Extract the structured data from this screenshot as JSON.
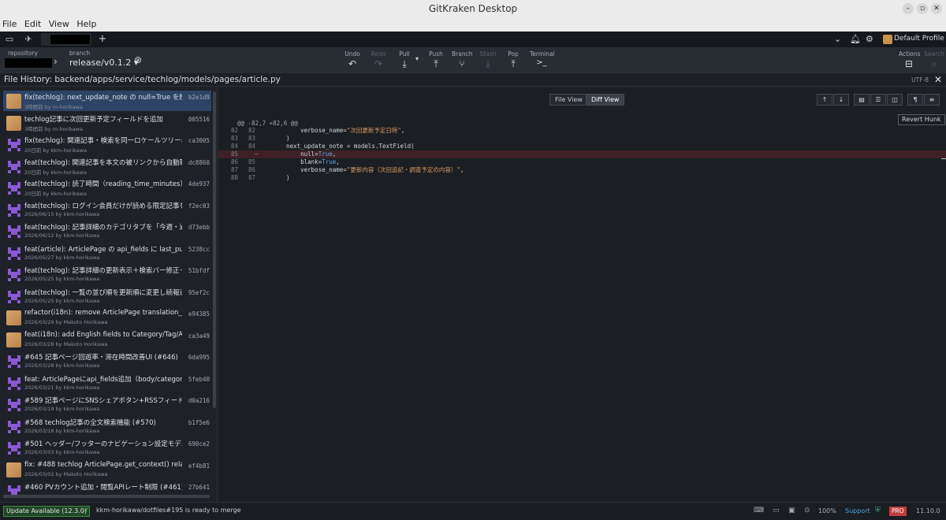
{
  "window": {
    "title": "GitKraken Desktop"
  },
  "menu": [
    "File",
    "Edit",
    "View",
    "Help"
  ],
  "tabbar": {
    "profile": "Default Profile",
    "add_tab": "+"
  },
  "toolbar": {
    "repository_label": "repository",
    "branch_label": "branch",
    "branch_name": "release/v0.1.2",
    "actions": [
      {
        "label": "Undo",
        "icon": "↶"
      },
      {
        "label": "Redo",
        "icon": "↷"
      },
      {
        "label": "Pull",
        "icon": "⤓"
      },
      {
        "label": "Push",
        "icon": "⤒"
      },
      {
        "label": "Branch",
        "icon": "⑂"
      },
      {
        "label": "Stash",
        "icon": "⤓"
      },
      {
        "label": "Pop",
        "icon": "⤒"
      },
      {
        "label": "Terminal",
        "icon": ">_"
      }
    ],
    "right_actions": [
      "Actions",
      "Search"
    ]
  },
  "file_history": {
    "title": "File History: backend/apps/service/techlog/models/pages/article.py",
    "encoding": "UTF-8"
  },
  "commits": [
    {
      "message": "fix(techlog): next_update_note の null=True を削除・...",
      "meta": "3時間前 by m-horikawa",
      "sha": "b2e1d9",
      "avatar": "photo"
    },
    {
      "message": "techlog記事に次回更新予定フィールドを追加",
      "meta": "3時間前 by m-horikawa",
      "sha": "005516",
      "avatar": "photo"
    },
    {
      "message": "fix(techlog): 関連記事・検索を同一ロケールツリーに限...",
      "meta": "20日前 by kkm-horikawa",
      "sha": "ca3005",
      "avatar": "pixel"
    },
    {
      "message": "feat(techlog): 関連記事を本文の被リンクから自動取得...",
      "meta": "20日前 by kkm-horikawa",
      "sha": "dc8860",
      "avatar": "pixel"
    },
    {
      "message": "feat(techlog): 読了時間（reading_time_minutes）を完...",
      "meta": "20日前 by kkm-horikawa",
      "sha": "4de937",
      "avatar": "pixel"
    },
    {
      "message": "feat(techlog): ログイン会員だけが読める限定記事を追...",
      "meta": "2026/06/15 by kkm-horikawa",
      "sha": "f2ec03",
      "avatar": "pixel"
    },
    {
      "message": "feat(techlog): 記事詳細のカテゴリタブを「今週・過去3...",
      "meta": "2026/06/12 by kkm-horikawa",
      "sha": "d73ebb",
      "avatar": "pixel"
    },
    {
      "message": "feat(article): ArticlePage の api_fields に last_publishe...",
      "meta": "2026/05/27 by kkm-horikawa",
      "sha": "5238cc",
      "avatar": "pixel"
    },
    {
      "message": "feat(techlog): 記事詳細の更新表示＋検索バー修正＋英...",
      "meta": "2026/05/25 by kkm-horikawa",
      "sha": "51bfdf",
      "avatar": "pixel"
    },
    {
      "message": "feat(techlog): 一覧の並び順を更新順に変更し続報追記...",
      "meta": "2026/05/25 by kkm-horikawa",
      "sha": "95ef2c",
      "avatar": "pixel"
    },
    {
      "message": "refactor(i18n): remove ArticlePage translation_of (no...",
      "meta": "2026/03/29 by Makoto Horikawa",
      "sha": "e94385",
      "avatar": "photo"
    },
    {
      "message": "feat(i18n): add English fields to Category/Tag/Author ...",
      "meta": "2026/03/28 by Makoto Horikawa",
      "sha": "ca3a49",
      "avatar": "photo"
    },
    {
      "message": "#645 記事ページ回遊率・滞在時間改善UI (#646)",
      "meta": "2026/03/28 by kkm-horikawa",
      "sha": "6da995",
      "avatar": "pixel"
    },
    {
      "message": "feat: ArticlePageにapi_fields追加（body/category/tags...",
      "meta": "2026/03/21 by kkm-horikawa",
      "sha": "5feb40",
      "avatar": "pixel"
    },
    {
      "message": "#589 記事ページにSNSシェアボタン+RSSフィードを追...",
      "meta": "2026/03/19 by kkm-horikawa",
      "sha": "d0a216",
      "avatar": "pixel"
    },
    {
      "message": "#568 techlog記事の全文検索機能 (#570)",
      "meta": "2026/03/18 by kkm-horikawa",
      "sha": "b1f5e6",
      "avatar": "pixel"
    },
    {
      "message": "#501 ヘッダー/フッターのナビゲーション設定モデル追...",
      "meta": "2026/03/03 by kkm-horikawa",
      "sha": "690ce2",
      "avatar": "pixel"
    },
    {
      "message": "fix: #488 techlog ArticlePage.get_context() related_lin...",
      "meta": "2026/03/02 by Makoto Horikawa",
      "sha": "ef4b81",
      "avatar": "photo"
    },
    {
      "message": "#460 PVカウント追加・閲覧APIレート制限 (#461)",
      "meta": "",
      "sha": "27b641",
      "avatar": "pixel"
    }
  ],
  "diff": {
    "file_view_label": "File View",
    "diff_view_label": "Diff View",
    "revert_label": "Revert Hunk",
    "hunk_header": "@@ -82,7 +82,6 @@",
    "lines": [
      {
        "old": "82",
        "new": "82",
        "code": "        verbose_name=\"次回更新予定日時\",",
        "type": "context"
      },
      {
        "old": "83",
        "new": "83",
        "code": "    )",
        "type": "context"
      },
      {
        "old": "84",
        "new": "84",
        "code": "    next_update_note = models.TextField(",
        "type": "context"
      },
      {
        "old": "85",
        "new": "",
        "code": "        null=True,",
        "type": "removed"
      },
      {
        "old": "86",
        "new": "85",
        "code": "        blank=True,",
        "type": "context"
      },
      {
        "old": "87",
        "new": "86",
        "code": "        verbose_name=\"更新内容（次回追記・調査予定の内容）\",",
        "type": "context"
      },
      {
        "old": "88",
        "new": "87",
        "code": "    )",
        "type": "context"
      }
    ]
  },
  "status": {
    "update": "Update Available (12.3.0)",
    "message": "kkm-horikawa/dotfiles#195 is ready to merge",
    "zoom": "100%",
    "support": "Support",
    "pro": "PRO",
    "version": "11.10.0"
  }
}
